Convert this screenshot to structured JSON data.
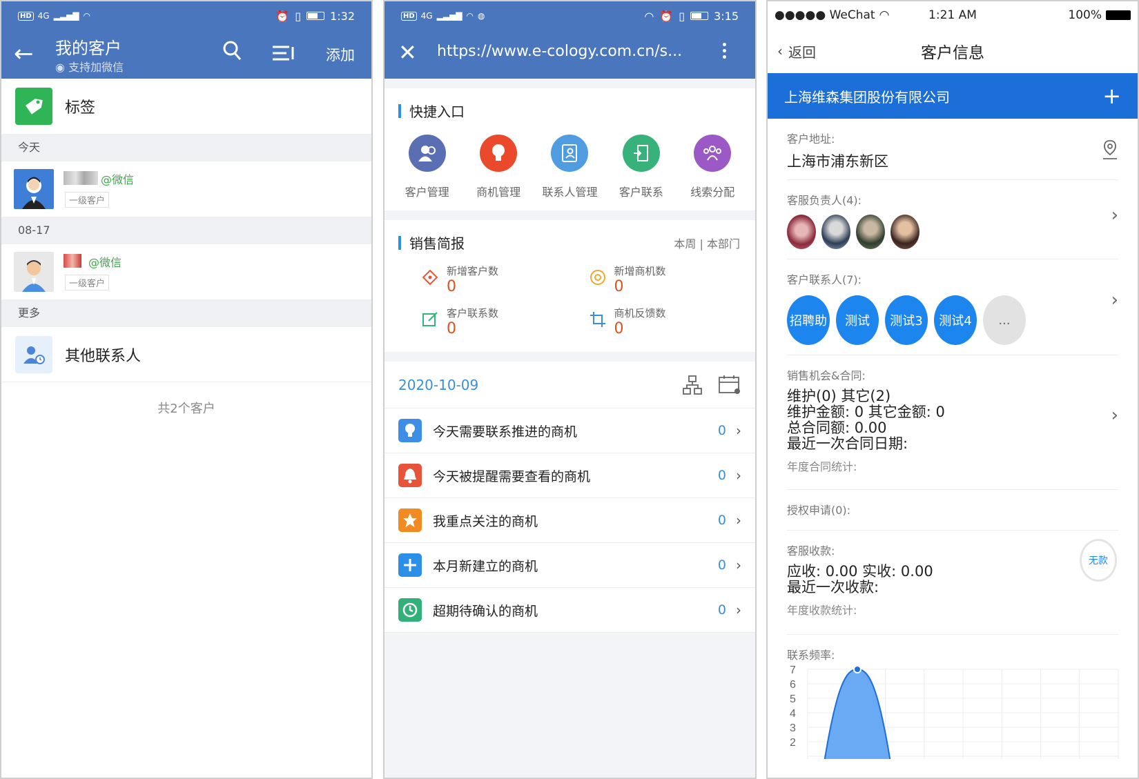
{
  "p1": {
    "status": {
      "net": "4G",
      "time": "1:32"
    },
    "header": {
      "title": "我的客户",
      "subtitle": "支持加微信",
      "add_label": "添加"
    },
    "tag_label": "标签",
    "groups": [
      {
        "title": "今天",
        "contacts": [
          {
            "wechat": "@微信",
            "level": "一级客户"
          }
        ]
      },
      {
        "title": "08-17",
        "contacts": [
          {
            "wechat": "@微信",
            "level": "一级客户"
          }
        ]
      }
    ],
    "more": {
      "title": "更多",
      "other_label": "其他联系人"
    },
    "total": "共2个客户"
  },
  "p2": {
    "status": {
      "net": "4G",
      "time": "3:15"
    },
    "url": "https://www.e-cology.com.cn/s...",
    "quick": {
      "title": "快捷入口",
      "items": [
        {
          "label": "客户管理",
          "color": "#5a6fb3"
        },
        {
          "label": "商机管理",
          "color": "#ea4a2b"
        },
        {
          "label": "联系人管理",
          "color": "#4f9de0"
        },
        {
          "label": "客户联系",
          "color": "#38b27b"
        },
        {
          "label": "线索分配",
          "color": "#9b59c6"
        }
      ]
    },
    "sales": {
      "title": "销售简报",
      "scope": "本周 | 本部门",
      "stats": [
        {
          "label": "新增客户数",
          "value": "0"
        },
        {
          "label": "新增商机数",
          "value": "0"
        },
        {
          "label": "客户联系数",
          "value": "0"
        },
        {
          "label": "商机反馈数",
          "value": "0"
        }
      ]
    },
    "date": "2020-10-09",
    "opportunities": [
      {
        "label": "今天需要联系推进的商机",
        "count": "0",
        "icon": "bulb-icon",
        "color": "#3d8ee6"
      },
      {
        "label": "今天被提醒需要查看的商机",
        "count": "0",
        "icon": "bell-icon",
        "color": "#e8543a"
      },
      {
        "label": "我重点关注的商机",
        "count": "0",
        "icon": "star-icon",
        "color": "#f08a23"
      },
      {
        "label": "本月新建立的商机",
        "count": "0",
        "icon": "plus-icon",
        "color": "#2b8fe8"
      },
      {
        "label": "超期待确认的商机",
        "count": "0",
        "icon": "clock-icon",
        "color": "#32b07a"
      }
    ]
  },
  "p3": {
    "status": {
      "carrier": "●●●●● WeChat",
      "time": "1:21 AM",
      "battery": "100%"
    },
    "nav": {
      "back": "返回",
      "title": "客户信息"
    },
    "company": "上海维森集团股份有限公司",
    "address": {
      "label": "客户地址:",
      "value": "上海市浦东新区"
    },
    "owners": {
      "label": "客服负责人(4):"
    },
    "contacts": {
      "label": "客户联系人(7):",
      "chips": [
        "招聘助",
        "测试",
        "测试3",
        "测试4",
        "..."
      ]
    },
    "sales": {
      "label": "销售机会&合同:",
      "lines": [
        "维护(0) 其它(2)",
        "维护金额: 0 其它金额: 0",
        "总合同额: 0.00",
        "最近一次合同日期:"
      ],
      "annual": "年度合同统计:"
    },
    "auth": {
      "label": "授权申请(0):"
    },
    "payment": {
      "label": "客服收款:",
      "lines": [
        "应收: 0.00 实收: 0.00",
        "最近一次收款:"
      ],
      "annual": "年度收款统计:",
      "stamp": "无款"
    },
    "frequency": {
      "label": "联系频率:"
    }
  },
  "chart_data": {
    "type": "area",
    "ylim": [
      1,
      7
    ],
    "yticks": [
      "7",
      "6",
      "5",
      "4",
      "3",
      "2"
    ],
    "grid": true,
    "series": [
      {
        "values": [
          0,
          7,
          0
        ]
      }
    ],
    "color": "#6aaaf5"
  }
}
